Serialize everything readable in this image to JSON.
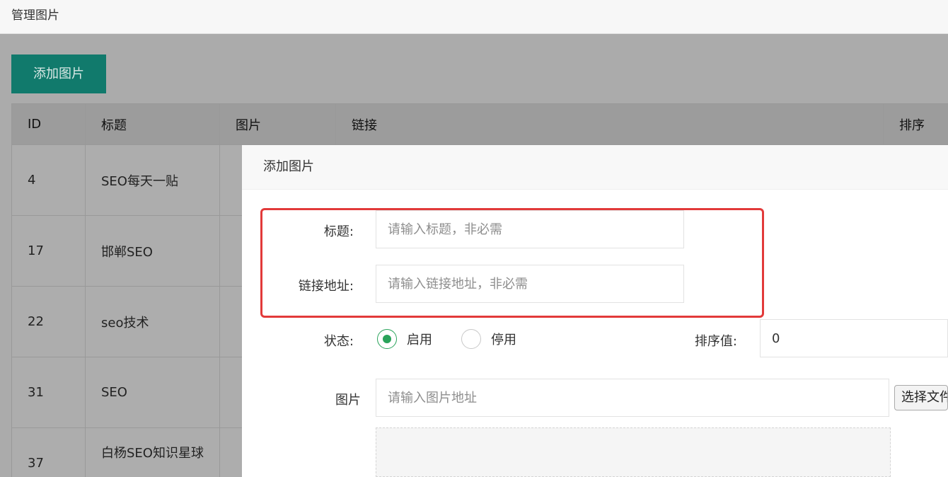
{
  "page": {
    "title": "管理图片"
  },
  "toolbar": {
    "add_label": "添加图片"
  },
  "table": {
    "headers": [
      "ID",
      "标题",
      "图片",
      "链接",
      "排序"
    ],
    "rows": [
      {
        "id": "4",
        "title": "SEO每天一贴"
      },
      {
        "id": "17",
        "title": "邯郸SEO"
      },
      {
        "id": "22",
        "title": "seo技术"
      },
      {
        "id": "31",
        "title": "SEO"
      },
      {
        "id": "37",
        "title": "白杨SEO知识星球"
      }
    ]
  },
  "dialog": {
    "title": "添加图片",
    "fields": {
      "title_label": "标题:",
      "title_placeholder": "请输入标题，非必需",
      "link_label": "链接地址:",
      "link_placeholder": "请输入链接地址，非必需",
      "status_label": "状态:",
      "status_on": "启用",
      "status_off": "停用",
      "sort_label": "排序值:",
      "sort_value": "0",
      "image_label": "图片",
      "image_placeholder": "请输入图片地址",
      "file_button": "选择文件"
    }
  },
  "colors": {
    "primary": "#117a6c",
    "highlight": "#e23a3a",
    "radio_active": "#29a35a"
  }
}
